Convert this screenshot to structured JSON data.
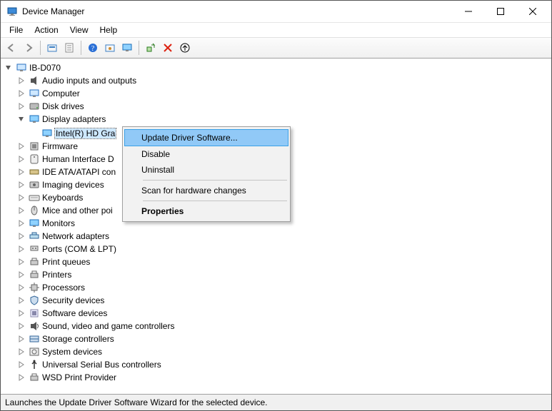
{
  "window": {
    "title": "Device Manager"
  },
  "menubar": {
    "items": [
      "File",
      "Action",
      "View",
      "Help"
    ]
  },
  "toolbar": {
    "buttons": [
      {
        "name": "back-icon"
      },
      {
        "name": "forward-icon"
      },
      {
        "name": "up-level-icon",
        "sep_before": true
      },
      {
        "name": "properties-icon"
      },
      {
        "name": "help-icon",
        "sep_before": true
      },
      {
        "name": "show-hidden-icon"
      },
      {
        "name": "monitor-icon"
      },
      {
        "name": "scan-icon",
        "sep_before": true
      },
      {
        "name": "uninstall-icon"
      },
      {
        "name": "update-icon"
      }
    ]
  },
  "tree": {
    "root": {
      "label": "IB-D070",
      "expanded": true
    },
    "items": [
      {
        "label": "Audio inputs and outputs",
        "icon": "audio-icon"
      },
      {
        "label": "Computer",
        "icon": "computer-icon"
      },
      {
        "label": "Disk drives",
        "icon": "disk-icon"
      },
      {
        "label": "Display adapters",
        "icon": "display-icon",
        "expanded": true,
        "children": [
          {
            "label": "Intel(R) HD Gra",
            "icon": "display-icon",
            "selected": true
          }
        ]
      },
      {
        "label": "Firmware",
        "icon": "firmware-icon"
      },
      {
        "label": "Human Interface D",
        "icon": "hid-icon"
      },
      {
        "label": "IDE ATA/ATAPI con",
        "icon": "ide-icon"
      },
      {
        "label": "Imaging devices",
        "icon": "imaging-icon"
      },
      {
        "label": "Keyboards",
        "icon": "keyboard-icon"
      },
      {
        "label": "Mice and other poi",
        "icon": "mouse-icon"
      },
      {
        "label": "Monitors",
        "icon": "monitor-icon"
      },
      {
        "label": "Network adapters",
        "icon": "network-icon"
      },
      {
        "label": "Ports (COM & LPT)",
        "icon": "port-icon"
      },
      {
        "label": "Print queues",
        "icon": "printer-icon"
      },
      {
        "label": "Printers",
        "icon": "printer-icon"
      },
      {
        "label": "Processors",
        "icon": "cpu-icon"
      },
      {
        "label": "Security devices",
        "icon": "security-icon"
      },
      {
        "label": "Software devices",
        "icon": "software-icon"
      },
      {
        "label": "Sound, video and game controllers",
        "icon": "sound-icon"
      },
      {
        "label": "Storage controllers",
        "icon": "storage-icon"
      },
      {
        "label": "System devices",
        "icon": "system-icon"
      },
      {
        "label": "Universal Serial Bus controllers",
        "icon": "usb-icon"
      },
      {
        "label": "WSD Print Provider",
        "icon": "printer-icon"
      }
    ]
  },
  "context_menu": {
    "items": [
      {
        "label": "Update Driver Software...",
        "highlight": true
      },
      {
        "label": "Disable"
      },
      {
        "label": "Uninstall"
      },
      {
        "sep": true
      },
      {
        "label": "Scan for hardware changes"
      },
      {
        "sep": true
      },
      {
        "label": "Properties",
        "bold": true
      }
    ]
  },
  "statusbar": {
    "text": "Launches the Update Driver Software Wizard for the selected device."
  }
}
